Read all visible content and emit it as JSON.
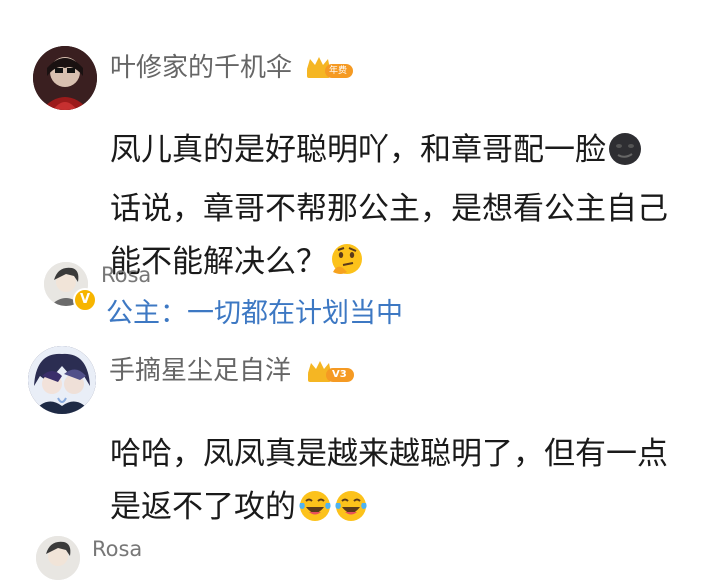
{
  "comments": [
    {
      "username": "叶修家的千机伞",
      "badge": "年费",
      "text_lines": [
        "凤儿真的是好聪明吖，和章哥配一脸",
        "话说，章哥不帮那公主，是想看公主自己",
        "能不能解决么？"
      ],
      "emoji_line1": "dark-moon-face-emoji",
      "emoji_line3": "thinking-face-emoji",
      "reply": {
        "username": "Rosa",
        "text": "公主：一切都在计划当中"
      }
    },
    {
      "username": "手摘星尘足自洋",
      "badge": "V3",
      "text_lines": [
        "哈哈，凤凤真是越来越聪明了，但有一点",
        "是返不了攻的"
      ],
      "emoji_line2": "tears-of-joy-emoji",
      "reply": {
        "username": "Rosa"
      }
    }
  ],
  "colors": {
    "username": "#666666",
    "body": "#1a1a1a",
    "reply_link": "#3d78c3",
    "crown": "#f5b623",
    "vip_badge": "#f7b500"
  }
}
